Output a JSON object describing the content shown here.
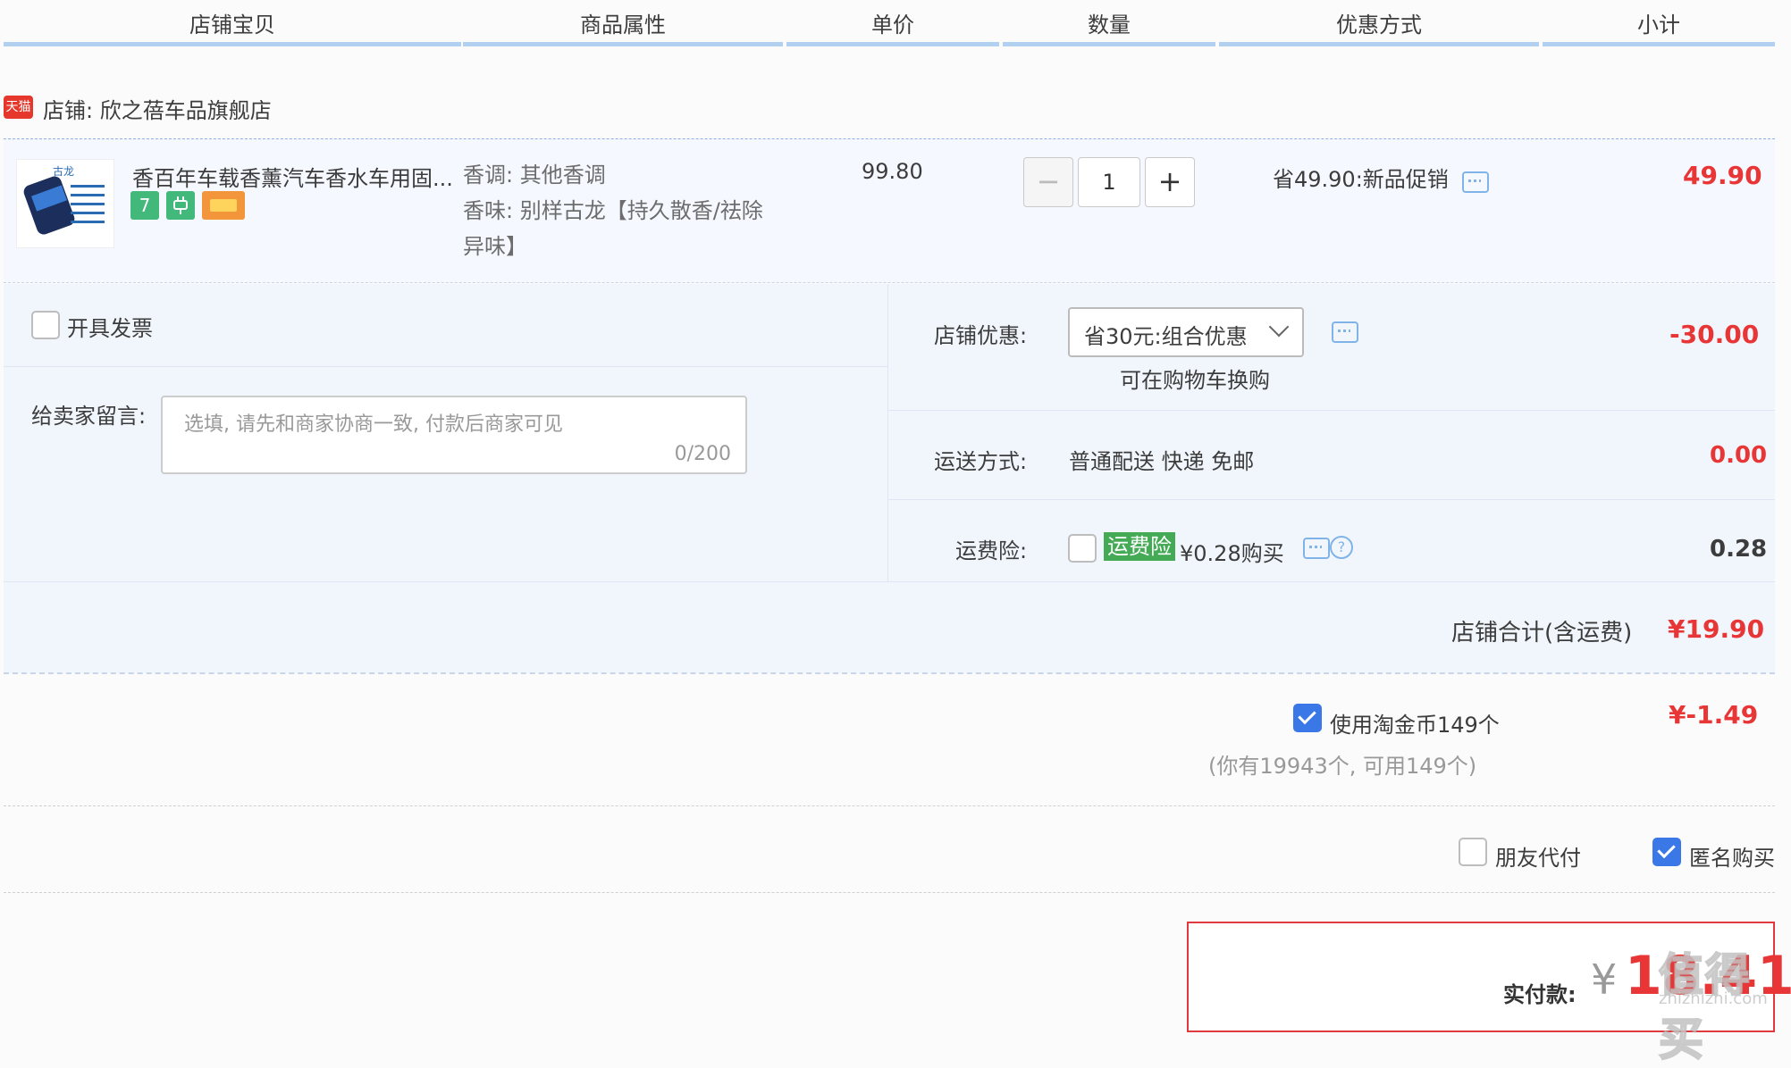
{
  "header": {
    "columns": [
      "店铺宝贝",
      "商品属性",
      "单价",
      "数量",
      "优惠方式",
      "小计"
    ]
  },
  "shop": {
    "badge": "天猫",
    "label": "店铺: 欣之蓓车品旗舰店"
  },
  "item": {
    "thumb_text": "古龙",
    "title": "香百年车载香薰汽车香水车用固...",
    "badge_7": "7",
    "attr_scent_tone": "香调: 其他香调",
    "attr_scent_line1": "香味: 别样古龙【持久散香/祛除",
    "attr_scent_line2": "异味】",
    "unit_price": "99.80",
    "qty_minus": "−",
    "qty_value": "1",
    "qty_plus": "+",
    "promo": "省49.90:新品促销",
    "subtotal": "49.90"
  },
  "options": {
    "invoice_label": "开具发票",
    "message_label": "给卖家留言:",
    "message_placeholder": "选填, 请先和商家协商一致, 付款后商家可见",
    "message_count": "0/200",
    "shop_discount_label": "店铺优惠:",
    "shop_discount_value": "省30元:组合优惠",
    "shop_discount_hint": "可在购物车换购",
    "shop_discount_amount": "-30.00",
    "shipping_label": "运送方式:",
    "shipping_value": "普通配送 快递 免邮",
    "shipping_amount": "0.00",
    "insurance_label": "运费险:",
    "insurance_tag": "运费险",
    "insurance_price": "¥0.28购买",
    "insurance_help": "?",
    "insurance_amount": "0.28"
  },
  "shop_total": {
    "label": "店铺合计(含运费)",
    "amount": "¥19.90"
  },
  "coins": {
    "label": "使用淘金币149个",
    "detail": "(你有19943个, 可用149个)",
    "amount": "¥-1.49",
    "checked": true
  },
  "payment_options": {
    "friend_pay_label": "朋友代付",
    "friend_pay_checked": false,
    "anonymous_label": "匿名购买",
    "anonymous_checked": true
  },
  "final": {
    "label": "实付款:",
    "currency": "¥",
    "amount": "18.41"
  },
  "watermark": {
    "text": "值得买",
    "url": "zhizhizhi.com"
  },
  "colors": {
    "accent_red": "#e83535",
    "header_bar": "#b2d1f0",
    "checkbox_blue": "#3a78e8",
    "insurance_green": "#44aa55"
  }
}
